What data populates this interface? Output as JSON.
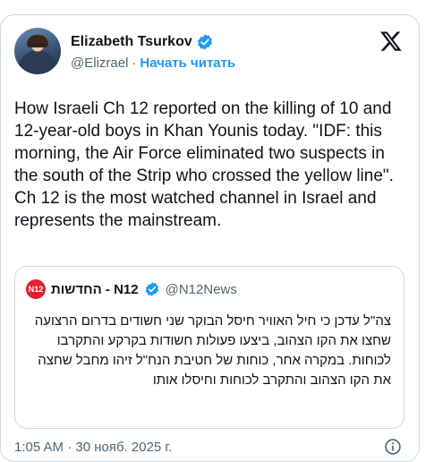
{
  "author": {
    "name": "Elizabeth Tsurkov",
    "handle": "@Elizrael",
    "separator": "·",
    "follow_label": "Начать читать"
  },
  "tweet": {
    "text": "How Israeli Ch 12 reported on the killing of 10 and 12-year-old boys in Khan Younis today. \"IDF: this morning, the Air Force eliminated two suspects in the south of the Strip who crossed the yellow line\". Ch 12 is the most watched channel in Israel and represents the mainstream."
  },
  "quoted_tweet": {
    "avatar_text": "N12",
    "name": "החדשות - N12",
    "handle": "@N12News",
    "text": "צה\"ל עדכן כי חיל האוויר חיסל הבוקר שני חשודים בדרום הרצועה שחצו את הקו הצהוב, ביצעו פעולות חשודות בקרקע והתקרבו לכוחות. במקרה אחר, כוחות של חטיבת הנח\"ל זיהו מחבל שחצה את הקו הצהוב והתקרב לכוחות וחיסלו אותו"
  },
  "footer": {
    "timestamp": "1:05 AM · 30 нояб. 2025 г."
  },
  "icons": {
    "verified": "verified-badge-icon",
    "x_logo": "x-logo-icon",
    "info": "info-icon"
  },
  "colors": {
    "accent": "#1d9bf0",
    "text_primary": "#0f1419",
    "text_secondary": "#536471",
    "border": "#cfd9de",
    "n12_red": "#e1222e"
  }
}
